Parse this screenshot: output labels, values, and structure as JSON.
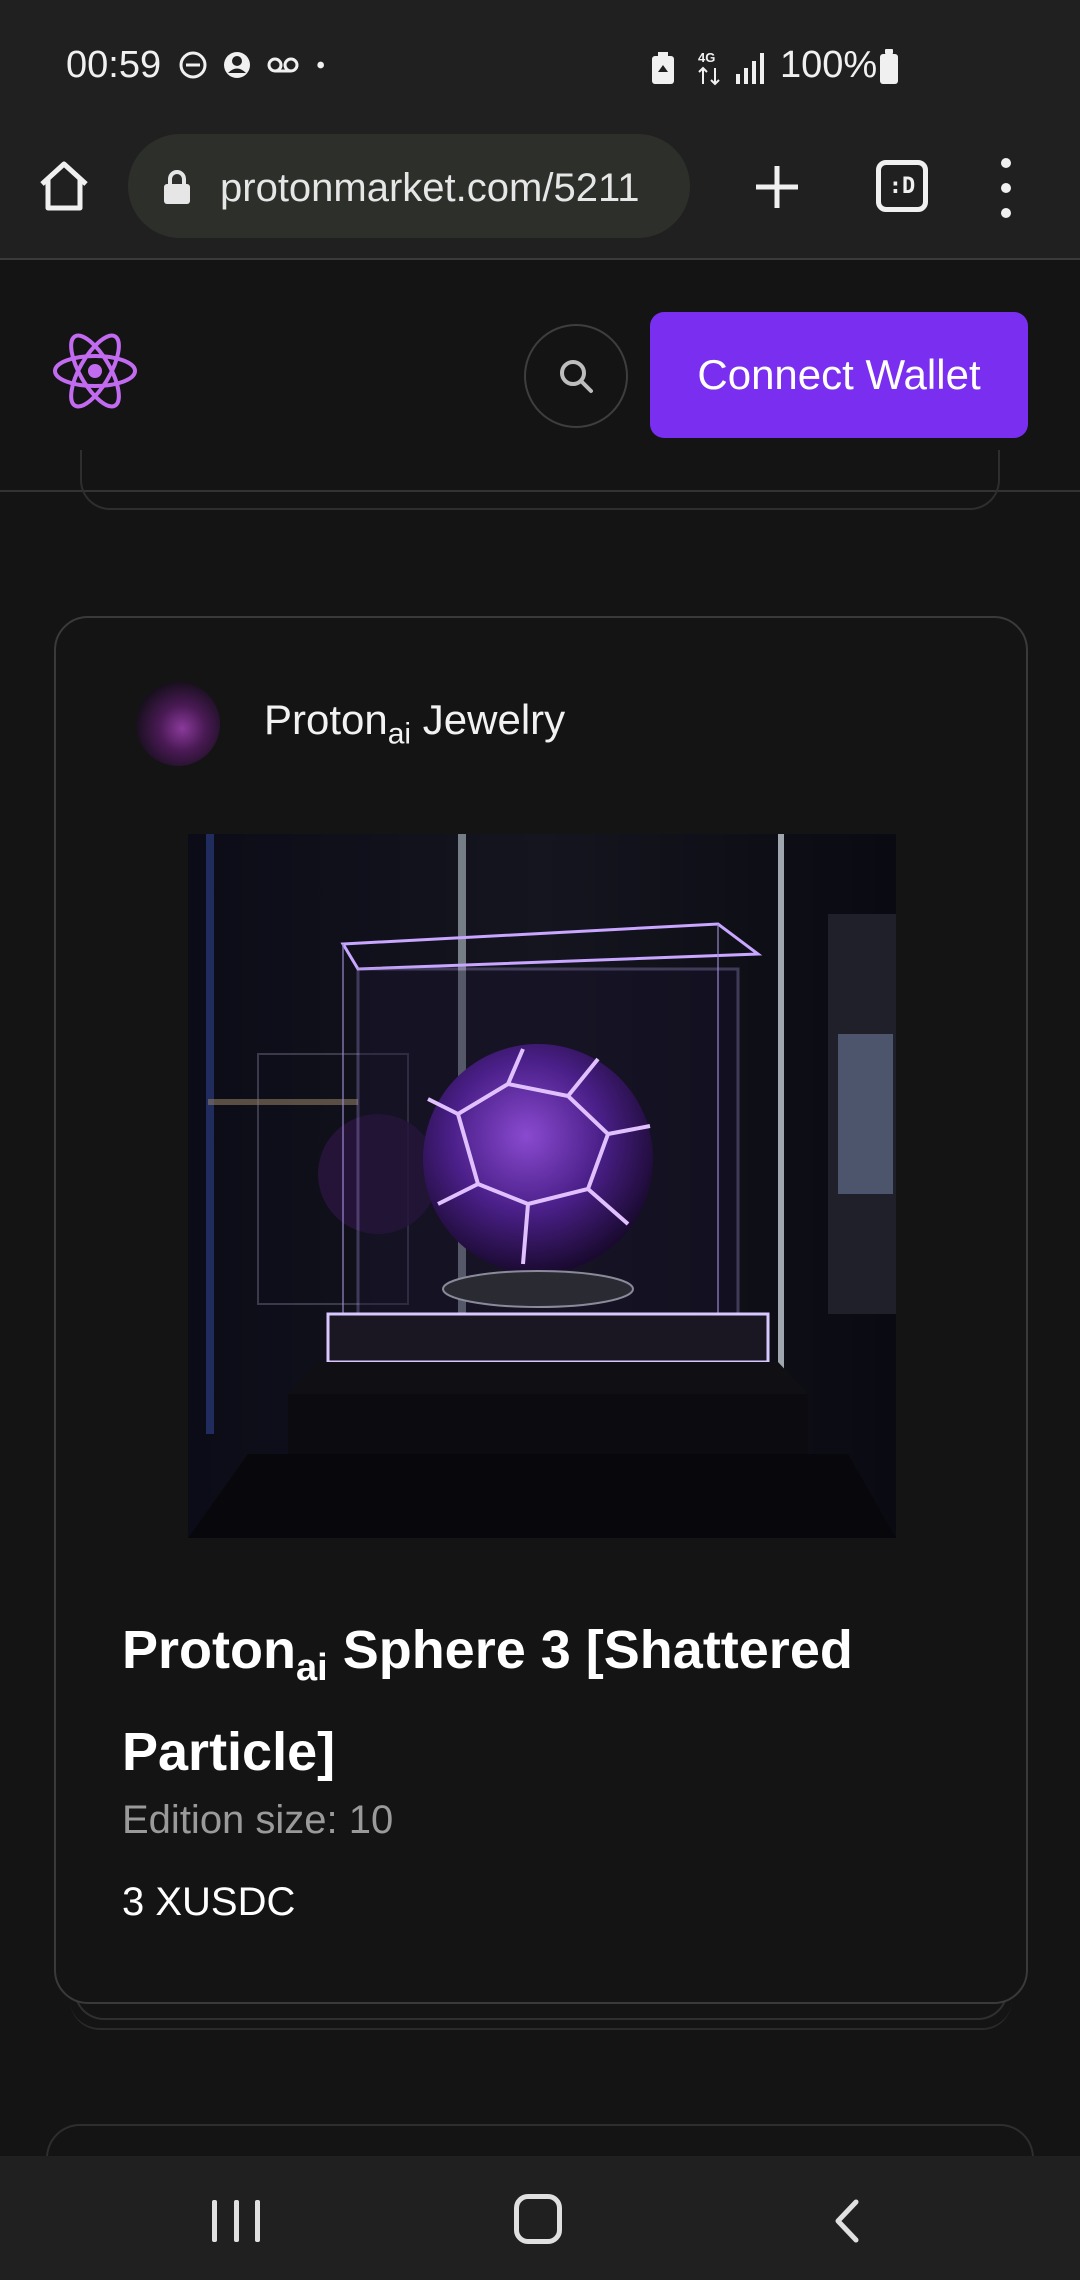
{
  "status_bar": {
    "time": "00:59",
    "battery_percent": "100%",
    "icons": [
      "dnd-icon",
      "account-icon",
      "voicemail-icon",
      "dot-icon",
      "battery-saver-icon",
      "4g-lte-icon",
      "signal-icon",
      "battery-icon"
    ]
  },
  "browser": {
    "url": "protonmarket.com/5211",
    "tab_label": ":D"
  },
  "header": {
    "connect_wallet_label": "Connect Wallet"
  },
  "card": {
    "creator_name": "Proton",
    "creator_sub": "ai",
    "creator_suffix": " Jewelry",
    "title_prefix": "Proton",
    "title_sub": "ai",
    "title_suffix": " Sphere 3 [Shattered Particle]",
    "edition": "Edition size: 10",
    "price": "3 XUSDC"
  },
  "colors": {
    "accent": "#7a2ff0",
    "logo": "#c26bf0",
    "background": "#141414"
  }
}
